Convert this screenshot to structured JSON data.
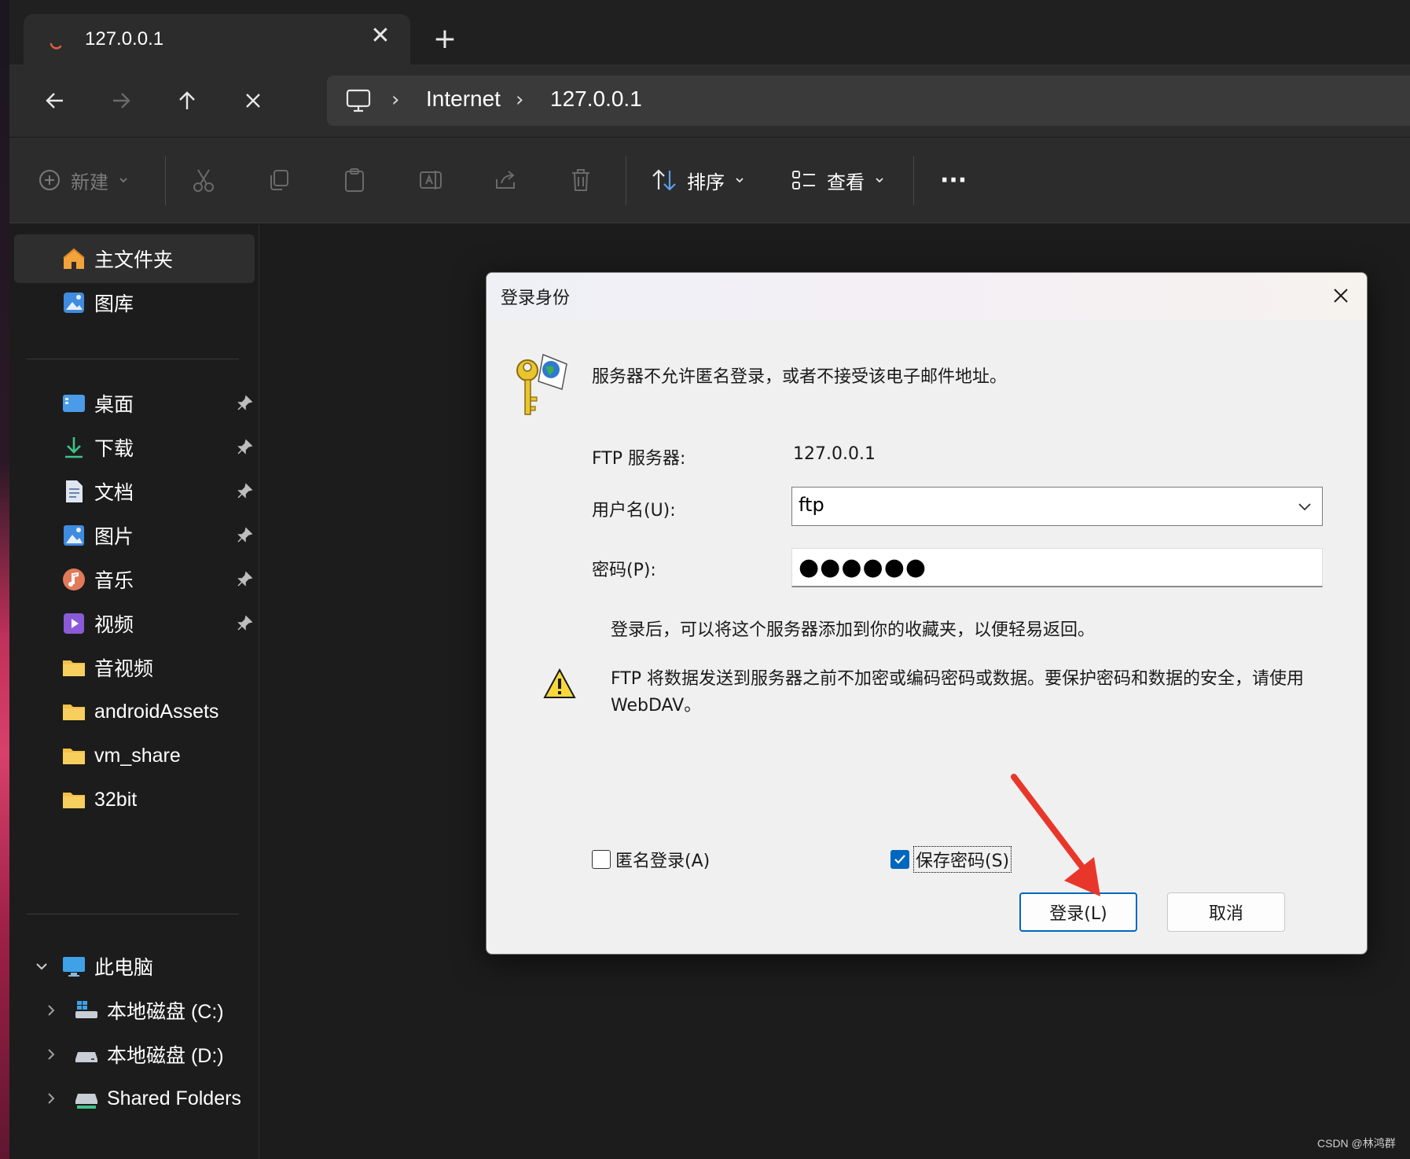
{
  "window": {
    "tab_title": "127.0.0.1",
    "new_tab_symbol": "+",
    "close_tab_symbol": "✕"
  },
  "address_bar": {
    "crumbs": [
      "Internet",
      "127.0.0.1"
    ]
  },
  "command_bar": {
    "new_label": "新建",
    "sort_label": "排序",
    "view_label": "查看",
    "more_label": "···"
  },
  "sidebar": {
    "quick": [
      {
        "label": "主文件夹",
        "icon": "home-icon",
        "selected": true
      },
      {
        "label": "图库",
        "icon": "gallery-icon"
      }
    ],
    "pinned": [
      {
        "label": "桌面",
        "icon": "desktop-icon",
        "pinned": true
      },
      {
        "label": "下载",
        "icon": "download-icon",
        "pinned": true
      },
      {
        "label": "文档",
        "icon": "document-icon",
        "pinned": true
      },
      {
        "label": "图片",
        "icon": "pictures-icon",
        "pinned": true
      },
      {
        "label": "音乐",
        "icon": "music-icon",
        "pinned": true
      },
      {
        "label": "视频",
        "icon": "video-icon",
        "pinned": true
      },
      {
        "label": "音视频",
        "icon": "folder-icon"
      },
      {
        "label": "androidAssets",
        "icon": "folder-icon"
      },
      {
        "label": "vm_share",
        "icon": "folder-icon"
      },
      {
        "label": "32bit",
        "icon": "folder-icon"
      }
    ],
    "this_pc": {
      "label": "此电脑",
      "icon": "pc-icon",
      "expanded": true
    },
    "drives": [
      {
        "label": "本地磁盘 (C:)",
        "icon": "drive-c-icon"
      },
      {
        "label": "本地磁盘 (D:)",
        "icon": "drive-icon"
      },
      {
        "label": "Shared Folders",
        "icon": "network-drive-icon"
      }
    ]
  },
  "dialog": {
    "title": "登录身份",
    "message": "服务器不允许匿名登录，或者不接受该电子邮件地址。",
    "server_label": "FTP 服务器:",
    "server_value": "127.0.0.1",
    "username_label": "用户名(U):",
    "username_value": "ftp",
    "password_label": "密码(P):",
    "password_value": "●●●●●●",
    "hint": "登录后，可以将这个服务器添加到你的收藏夹，以便轻易返回。",
    "warning": "FTP 将数据发送到服务器之前不加密或编码密码或数据。要保护密码和数据的安全，请使用 WebDAV。",
    "anonymous_label": "匿名登录(A)",
    "anonymous_checked": false,
    "save_password_label": "保存密码(S)",
    "save_password_checked": true,
    "login_button": "登录(L)",
    "cancel_button": "取消"
  },
  "colors": {
    "accent": "#0067c0",
    "annotation": "#e8372a"
  },
  "watermark": "CSDN @林鸿群"
}
